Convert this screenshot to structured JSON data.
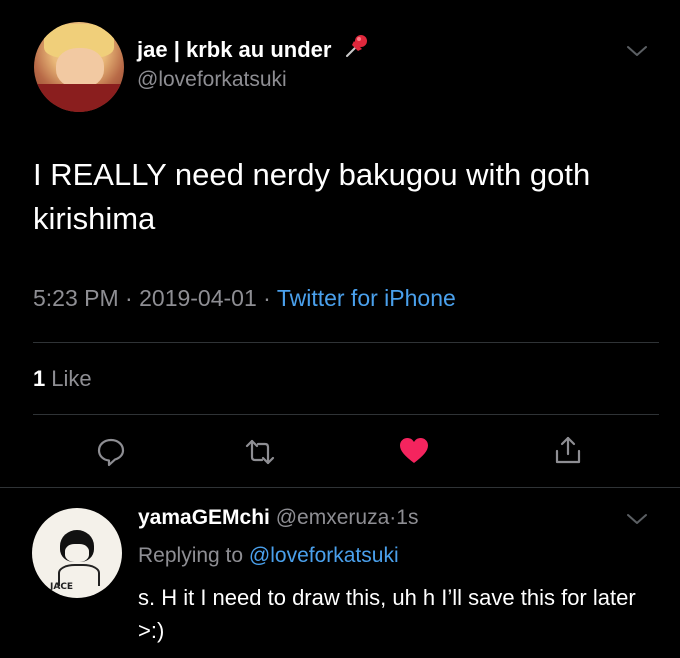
{
  "tweet": {
    "display_name": "jae | krbk au under",
    "handle": "@loveforkatsuki",
    "text": "I REALLY need nerdy bakugou with goth kirishima",
    "time": "5:23 PM",
    "date": "2019-04-01",
    "separator": "·",
    "source": "Twitter for iPhone",
    "like_count": "1",
    "like_label": "Like",
    "liked": true,
    "icons": {
      "name_emoji": "pushpin-icon",
      "menu": "chevron-down-icon",
      "reply": "reply-icon",
      "retweet": "retweet-icon",
      "like": "heart-icon",
      "share": "share-icon"
    },
    "colors": {
      "like_active": "#f4245e",
      "link": "#4aa0ec",
      "muted": "#8e8e93",
      "background": "#000000"
    }
  },
  "reply": {
    "display_name": "yamaGEMchi",
    "handle": "@emxeruza",
    "separator": "·",
    "age": "1s",
    "replying_prefix": "Replying to",
    "replying_to": "@loveforkatsuki",
    "text": "s. H it I need to draw this, uh h I’ll save this for later >:)",
    "avatar_text": "JACE"
  }
}
